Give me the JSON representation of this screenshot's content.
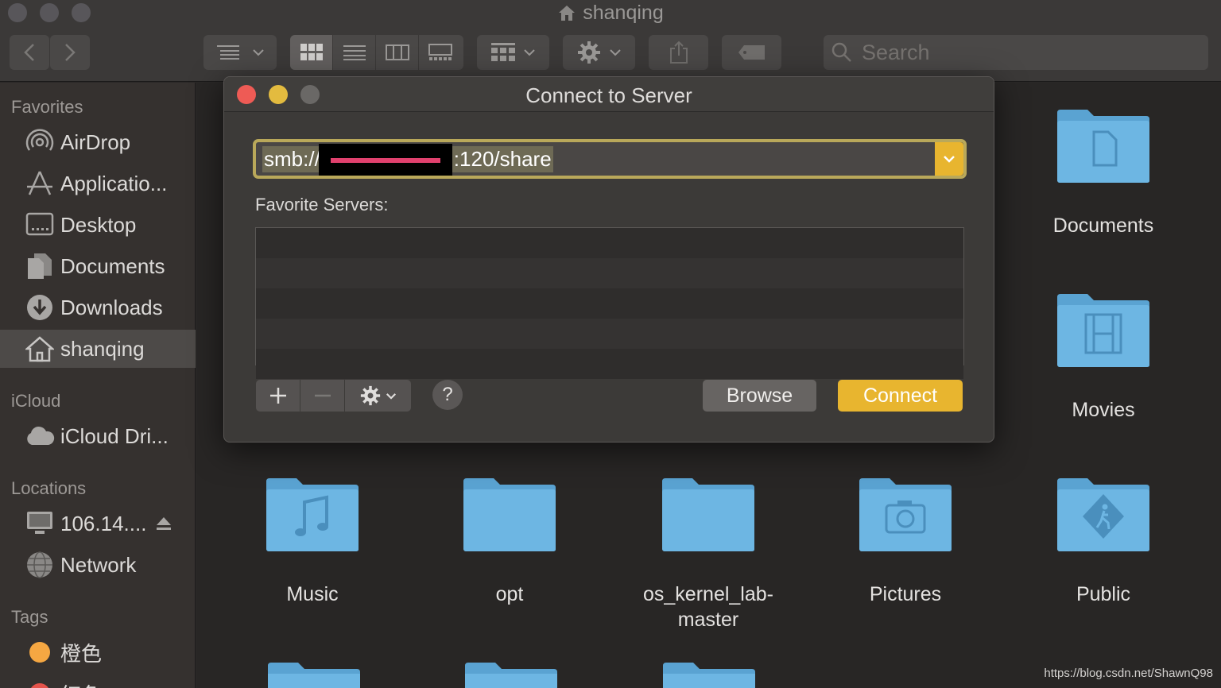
{
  "window": {
    "title": "shanqing"
  },
  "search": {
    "placeholder": "Search"
  },
  "sidebar": {
    "favorites_header": "Favorites",
    "favorites": [
      {
        "label": "AirDrop",
        "icon": "airdrop-icon"
      },
      {
        "label": "Applicatio...",
        "icon": "applications-icon"
      },
      {
        "label": "Desktop",
        "icon": "desktop-icon"
      },
      {
        "label": "Documents",
        "icon": "document-icon"
      },
      {
        "label": "Downloads",
        "icon": "download-icon"
      },
      {
        "label": "shanqing",
        "icon": "home-icon",
        "selected": true
      }
    ],
    "icloud_header": "iCloud",
    "icloud": [
      {
        "label": "iCloud Dri...",
        "icon": "cloud-icon"
      }
    ],
    "locations_header": "Locations",
    "locations": [
      {
        "label": "106.14....",
        "icon": "computer-icon"
      },
      {
        "label": "Network",
        "icon": "globe-icon"
      }
    ],
    "tags_header": "Tags",
    "tags": [
      {
        "label": "橙色",
        "color": "#f5a742"
      },
      {
        "label": "红色",
        "color": "#e5534b"
      }
    ]
  },
  "folders": [
    {
      "label": "Documents",
      "icon": "document-folder-icon"
    },
    {
      "label": "Movies",
      "icon": "film-folder-icon"
    },
    {
      "label": "Music",
      "icon": "music-folder-icon"
    },
    {
      "label": "opt",
      "icon": "folder-icon"
    },
    {
      "label": "os_kernel_lab-master",
      "icon": "folder-icon"
    },
    {
      "label": "Pictures",
      "icon": "camera-folder-icon"
    },
    {
      "label": "Public",
      "icon": "public-folder-icon"
    }
  ],
  "dialog": {
    "title": "Connect to Server",
    "address_prefix": "smb://",
    "address_suffix": ":120/share",
    "favorite_servers_label": "Favorite Servers:",
    "help_label": "?",
    "browse_label": "Browse",
    "connect_label": "Connect"
  },
  "watermark": "https://blog.csdn.net/ShawnQ98",
  "colors": {
    "accent": "#e8b52f",
    "folder": "#66b0dd",
    "close": "#ee5b55",
    "minimize": "#e3bb3f"
  }
}
